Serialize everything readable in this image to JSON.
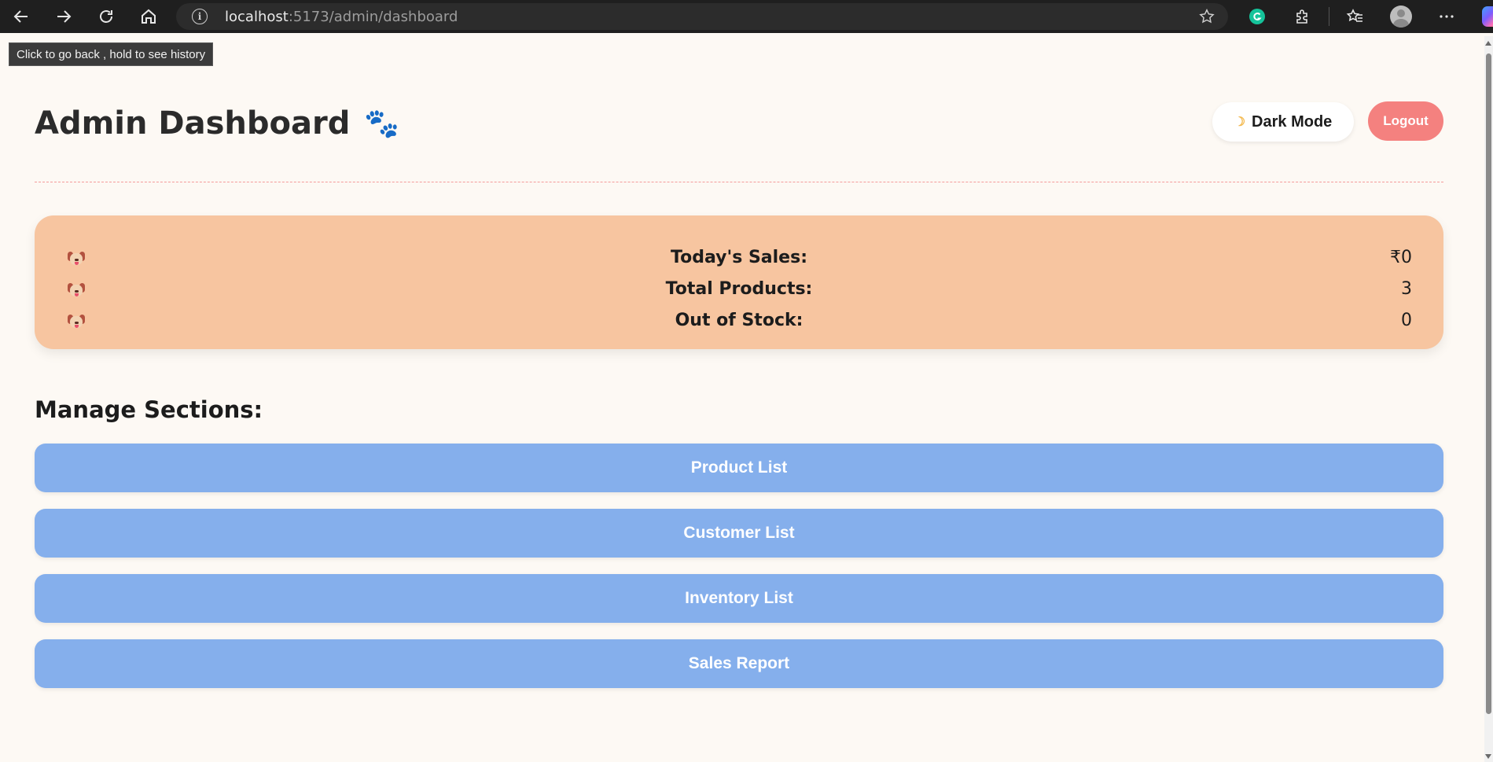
{
  "browser": {
    "url_host": "localhost",
    "url_path": ":5173/admin/dashboard",
    "tooltip": "Click to go back , hold to see history"
  },
  "header": {
    "title": "Admin Dashboard",
    "title_icon": "paw-icon",
    "dark_mode_label": "Dark Mode",
    "logout_label": "Logout"
  },
  "stats": [
    {
      "icon": "dog-icon",
      "label": "Today's Sales:",
      "value": "₹0"
    },
    {
      "icon": "dog-icon",
      "label": "Total Products:",
      "value": "3"
    },
    {
      "icon": "dog-icon",
      "label": "Out of Stock:",
      "value": "0"
    }
  ],
  "manage": {
    "heading": "Manage Sections:",
    "buttons": [
      "Product List",
      "Customer List",
      "Inventory List",
      "Sales Report"
    ]
  },
  "colors": {
    "page_bg": "#fdf9f4",
    "stats_bg": "#f7c5a0",
    "section_button": "#85afec",
    "logout": "#f4817f",
    "divider": "#f49a9a"
  }
}
